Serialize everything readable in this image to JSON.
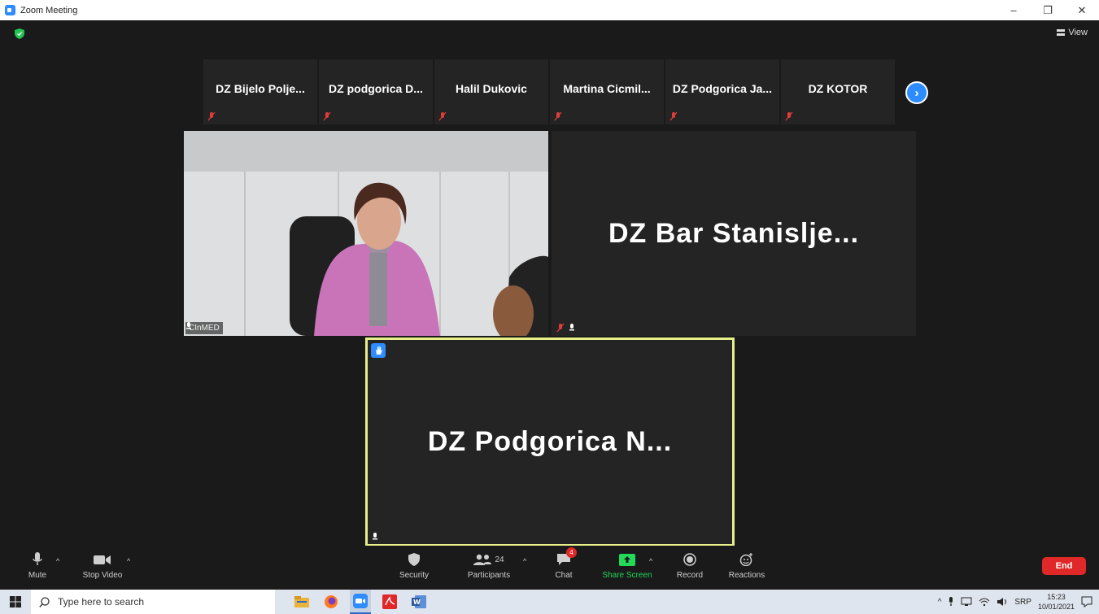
{
  "window": {
    "title": "Zoom Meeting",
    "minimize": "–",
    "restore": "❐",
    "close": "✕"
  },
  "meeting": {
    "view_label": "View",
    "gallery_strip": [
      {
        "name": "DZ Bijelo Polje..."
      },
      {
        "name": "DZ podgorica D..."
      },
      {
        "name": "Halil Dukovic"
      },
      {
        "name": "Martina  Cicmil..."
      },
      {
        "name": "DZ Podgorica Ja..."
      },
      {
        "name": "DZ KOTOR"
      }
    ],
    "next_page": "›",
    "video_tile": {
      "name": "CInMED"
    },
    "tile_b": {
      "name": "DZ Bar Stanislje..."
    },
    "tile_c": {
      "name": "DZ Podgorica N..."
    }
  },
  "toolbar": {
    "mute": "Mute",
    "stop_video": "Stop Video",
    "security": "Security",
    "participants": "Participants",
    "participants_count": "24",
    "chat": "Chat",
    "chat_badge": "4",
    "share_screen": "Share Screen",
    "record": "Record",
    "reactions": "Reactions",
    "end": "End",
    "share_color": "#23d959",
    "end_color": "#e02828"
  },
  "taskbar": {
    "search_placeholder": "Type here to search",
    "language": "SRP",
    "time": "15:23",
    "date": "10/01/2021"
  }
}
